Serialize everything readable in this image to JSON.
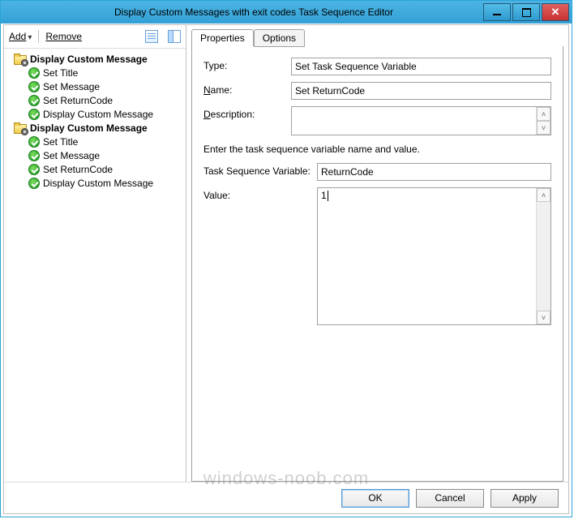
{
  "window": {
    "title": "Display Custom Messages with exit codes Task Sequence Editor"
  },
  "toolbar": {
    "add_label": "Add",
    "remove_label": "Remove"
  },
  "tree": [
    {
      "level": 0,
      "icon": "folder",
      "bold": true,
      "label": "Display Custom Message"
    },
    {
      "level": 1,
      "icon": "check",
      "bold": false,
      "label": "Set Title"
    },
    {
      "level": 1,
      "icon": "check",
      "bold": false,
      "label": "Set Message"
    },
    {
      "level": 1,
      "icon": "check",
      "bold": false,
      "label": "Set ReturnCode"
    },
    {
      "level": 1,
      "icon": "check",
      "bold": false,
      "label": "Display Custom Message"
    },
    {
      "level": 0,
      "icon": "folder",
      "bold": true,
      "label": "Display Custom Message"
    },
    {
      "level": 1,
      "icon": "check",
      "bold": false,
      "label": "Set Title"
    },
    {
      "level": 1,
      "icon": "check",
      "bold": false,
      "label": "Set Message"
    },
    {
      "level": 1,
      "icon": "check",
      "bold": false,
      "label": "Set ReturnCode"
    },
    {
      "level": 1,
      "icon": "check",
      "bold": false,
      "label": "Display Custom Message"
    }
  ],
  "tabs": {
    "properties": "Properties",
    "options": "Options"
  },
  "fields": {
    "type_label": "Type:",
    "type_value": "Set Task Sequence Variable",
    "name_label": "Name:",
    "name_value": "Set ReturnCode",
    "description_label": "Description:",
    "description_value": "",
    "hint": "Enter the task sequence variable name and value.",
    "var_label": "Task Sequence Variable:",
    "var_value": "ReturnCode",
    "value_label": "Value:",
    "value_value": "1"
  },
  "buttons": {
    "ok": "OK",
    "cancel": "Cancel",
    "apply": "Apply"
  },
  "watermark": "windows-noob.com"
}
